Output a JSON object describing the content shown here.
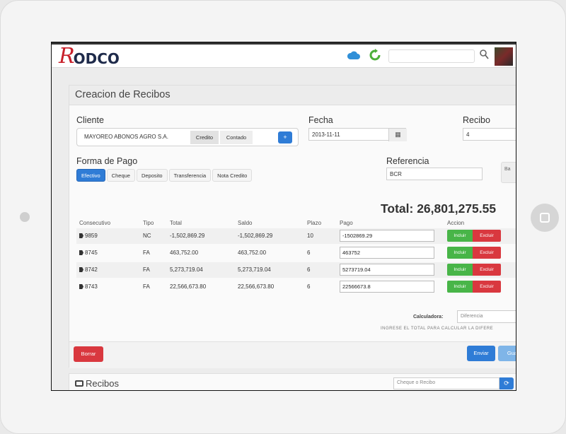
{
  "app": {
    "logo_mark": "R",
    "logo_text": "ODCO"
  },
  "topbar": {
    "icons": [
      "cloud-icon",
      "sync-icon",
      "search-icon"
    ],
    "search_placeholder": ""
  },
  "form": {
    "title": "Creacion de Recibos",
    "cliente_label": "Cliente",
    "cliente_value": "MAYOREO ABONOS AGRO S.A.",
    "credit_options": [
      "Credito",
      "Contado"
    ],
    "add_label": "+",
    "fecha_label": "Fecha",
    "fecha_value": "2013-11-11",
    "recibo_label": "Recibo",
    "recibo_value": "4",
    "forma_pago_label": "Forma de Pago",
    "payment_methods": [
      "Efectivo",
      "Cheque",
      "Deposito",
      "Transferencia",
      "Nota Credito"
    ],
    "active_method": "Efectivo",
    "referencia_label": "Referencia",
    "referencia_value": "BCR",
    "side_stub": "Ba",
    "total_label": "Total: 26,801,275.55"
  },
  "table": {
    "headers": [
      "Consecutivo",
      "Tipo",
      "Total",
      "Saldo",
      "Plazo",
      "Pago",
      "Accion"
    ],
    "rows": [
      {
        "consecutivo": "9859",
        "tipo": "NC",
        "total": "-1,502,869.29",
        "saldo": "-1,502,869.29",
        "plazo": "10",
        "pago": "-1502869.29"
      },
      {
        "consecutivo": "8745",
        "tipo": "FA",
        "total": "463,752.00",
        "saldo": "463,752.00",
        "plazo": "6",
        "pago": "463752"
      },
      {
        "consecutivo": "8742",
        "tipo": "FA",
        "total": "5,273,719.04",
        "saldo": "5,273,719.04",
        "plazo": "6",
        "pago": "5273719.04"
      },
      {
        "consecutivo": "8743",
        "tipo": "FA",
        "total": "22,566,673.80",
        "saldo": "22,566,673.80",
        "plazo": "6",
        "pago": "22566673.8"
      }
    ],
    "incluir_label": "Incluir",
    "excluir_label": "Excluir"
  },
  "calculator": {
    "label": "Calculadora:",
    "placeholder": "Diferencia",
    "hint": "INGRESE EL TOTAL PARA CALCULAR LA DIFERE"
  },
  "footer": {
    "borrar_label": "Borrar",
    "enviar_label": "Enviar",
    "guardar_label": "Gua"
  },
  "recibos": {
    "title": "Recibos",
    "search_placeholder": "Cheque o Recibo",
    "search_btn": "⟳"
  },
  "colors": {
    "primary": "#2f7cd6",
    "success": "#48b548",
    "danger": "#d9383f",
    "brand_red": "#c8202a",
    "brand_navy": "#1e2a4a"
  }
}
